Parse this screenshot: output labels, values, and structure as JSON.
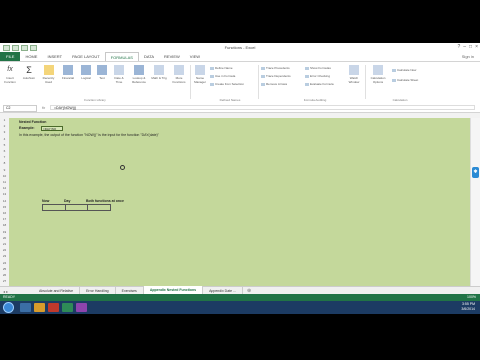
{
  "window": {
    "title": "Functions - Excel",
    "sign_in": "Sign in"
  },
  "ribbon_tabs": [
    "FILE",
    "HOME",
    "INSERT",
    "PAGE LAYOUT",
    "FORMULAS",
    "DATA",
    "REVIEW",
    "VIEW"
  ],
  "ribbon": {
    "insert_function": "Insert Function",
    "autosum": "AutoSum",
    "recently_used": "Recently Used",
    "financial": "Financial",
    "logical": "Logical",
    "text": "Text",
    "date_time": "Date & Time",
    "lookup_reference": "Lookup & Reference",
    "math_trig": "Math & Trig",
    "more_functions": "More Functions",
    "name_manager": "Name Manager",
    "define_name": "Define Name",
    "use_in_formula": "Use in Formula",
    "create_from_selection": "Create from Selection",
    "trace_precedents": "Trace Precedents",
    "trace_dependents": "Trace Dependents",
    "remove_arrows": "Remove Arrows",
    "show_formulas": "Show Formulas",
    "error_checking": "Error Checking",
    "evaluate_formula": "Evaluate Formula",
    "watch_window": "Watch Window",
    "calculation_options": "Calculation Options",
    "calculate_now": "Calculate Now",
    "calculate_sheet": "Calculate Sheet",
    "group_function_library": "Function Library",
    "group_defined_names": "Defined Names",
    "group_formula_auditing": "Formula Auditing",
    "group_calculation": "Calculation"
  },
  "formula_bar": {
    "name_box": "C2",
    "fx": "fx",
    "content": "=DAY(NOW())"
  },
  "sheet": {
    "title": "Nested Function",
    "example_label": "Example:",
    "example_value": "=DAY(NO",
    "description": "In this example, the output of the function \"NOW()\" is the input for the function \"DAY(date)\"",
    "col_now": "Now",
    "col_day": "Day",
    "col_both": "Both functions at once"
  },
  "sheet_tabs": [
    "Absolute and Relative",
    "Error Handling",
    "Exercises",
    "Appendix Nested Functions",
    "Appendix Date ..."
  ],
  "active_sheet_index": 3,
  "status": {
    "ready": "READY",
    "zoom": "100%"
  },
  "taskbar": {
    "time": "3:55 PM",
    "date": "3/6/2014"
  }
}
